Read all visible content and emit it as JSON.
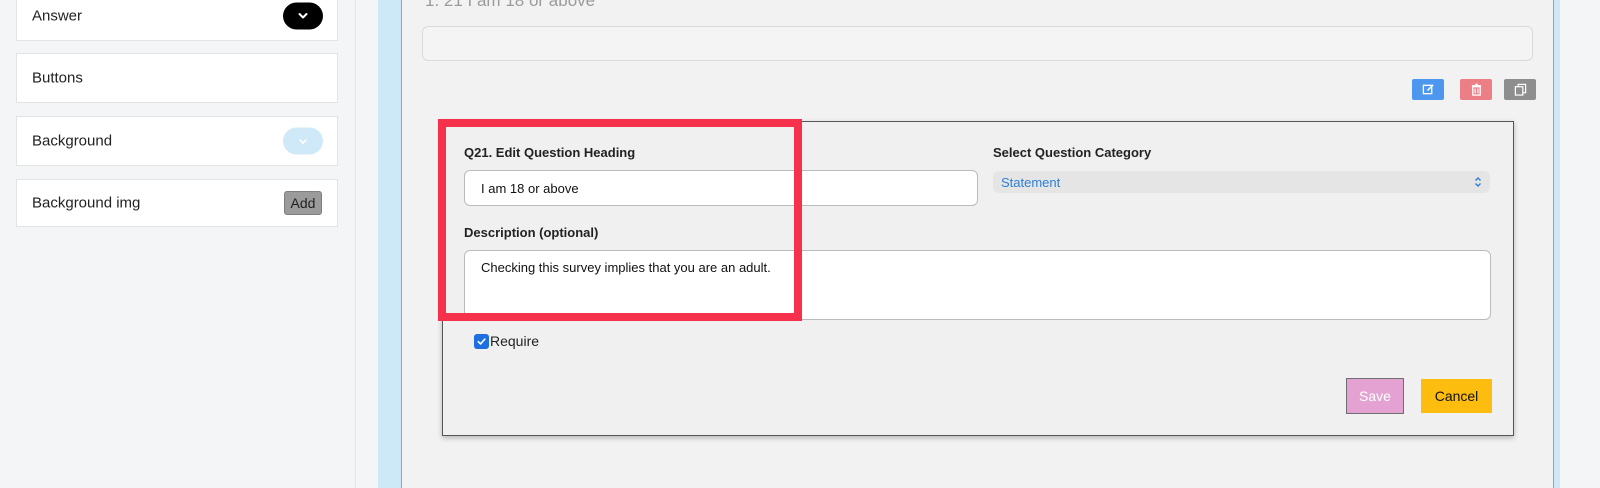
{
  "sidebar": {
    "items": [
      {
        "label": "Answer",
        "control": "chevron-down-icon",
        "control_color": "#000000"
      },
      {
        "label": "Buttons"
      },
      {
        "label": "Background",
        "control": "chevron-down-icon",
        "control_color": "#cfe9f8"
      },
      {
        "label": "Background img",
        "button_label": "Add"
      }
    ]
  },
  "preview": {
    "question_text": "1. 21 I am 18 or above"
  },
  "actions": {
    "edit_icon": "edit-icon",
    "delete_icon": "trash-icon",
    "copy_icon": "copy-icon"
  },
  "editor": {
    "heading_label": "Q21. Edit Question Heading",
    "heading_value": "I am 18 or above",
    "category_label": "Select Question Category",
    "category_value": "Statement",
    "description_label": "Description (optional)",
    "description_value": "Checking this survey implies that you are an adult.",
    "require_label": "Require",
    "require_checked": true,
    "save_label": "Save",
    "cancel_label": "Cancel"
  },
  "colors": {
    "highlight": "#f5314c",
    "save": "#e4a2d3",
    "cancel": "#fcbd0f",
    "edit": "#4d97ef",
    "delete": "#ec7f86",
    "copy": "#8e8e8e"
  }
}
